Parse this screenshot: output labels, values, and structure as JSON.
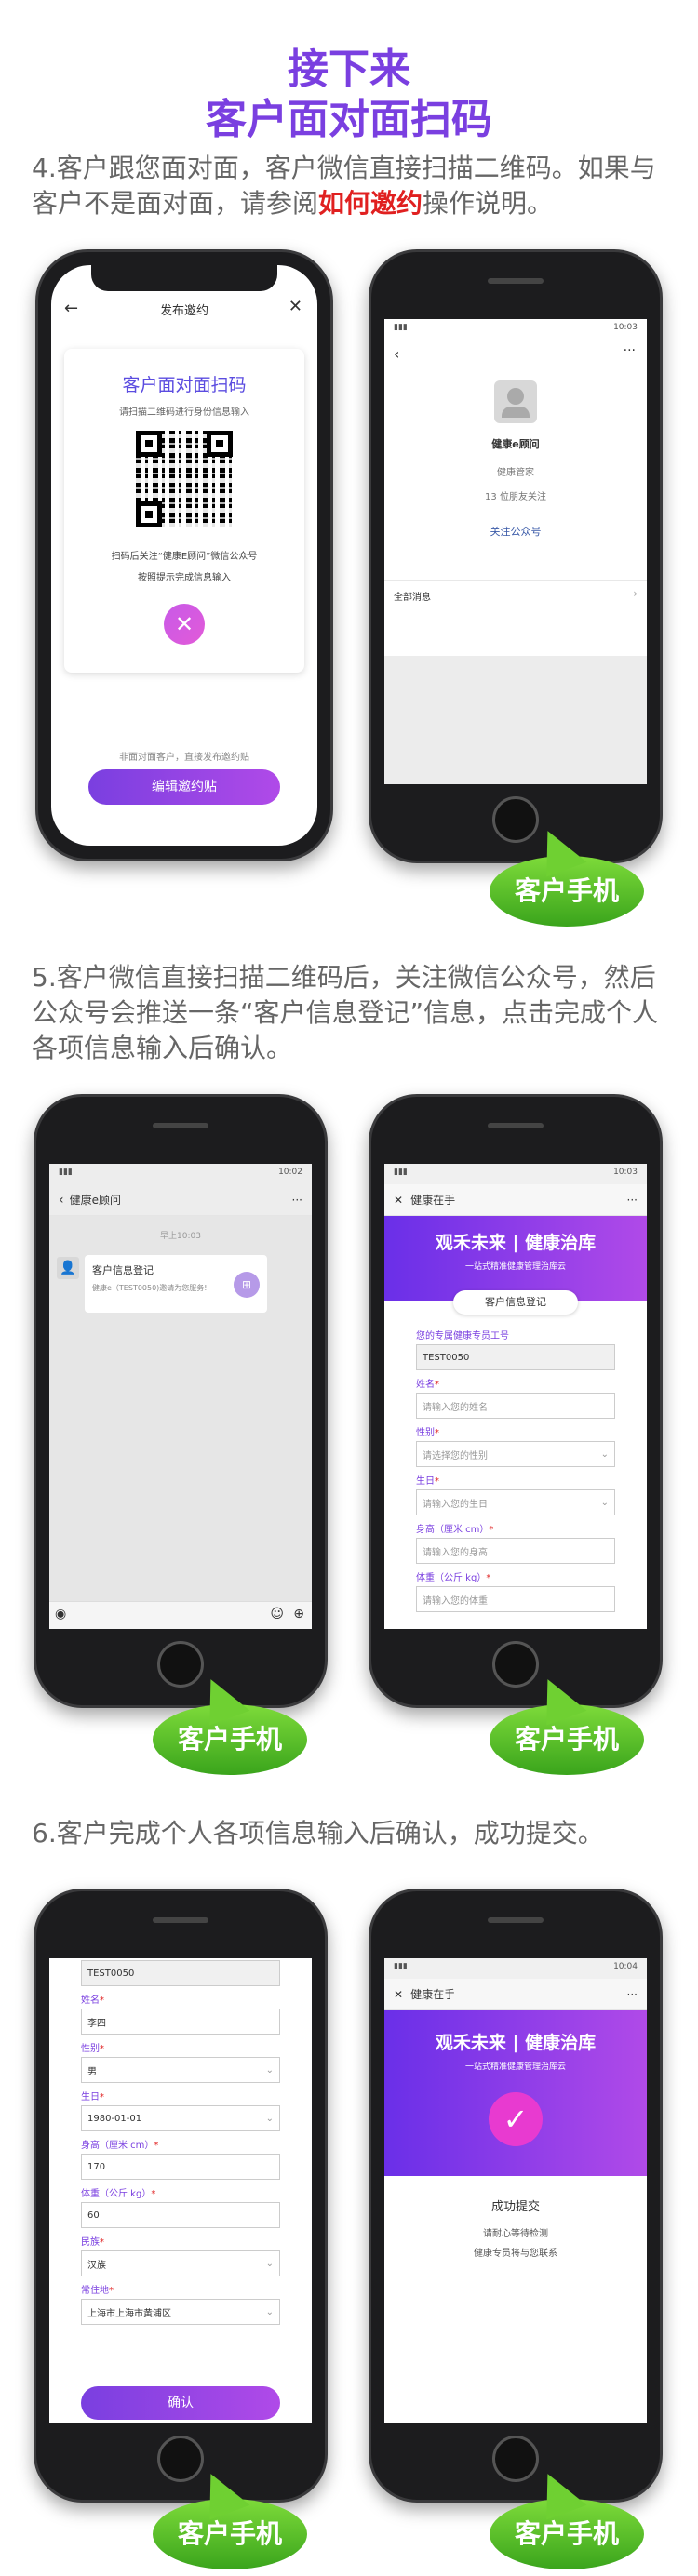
{
  "header": {
    "line1": "接下来",
    "line2": "客户面对面扫码"
  },
  "steps": {
    "s4_pre": "4.客户跟您面对面，客户微信直接扫描二维码。如果与客户不是面对面，请参阅",
    "s4_link": "如何邀约",
    "s4_post": "操作说明。",
    "s5": "5.客户微信直接扫描二维码后，关注微信公众号，然后公众号会推送一条“客户信息登记”信息，点击完成个人各项信息输入后确认。",
    "s6": "6.客户完成个人各项信息输入后确认，成功提交。"
  },
  "bubble_label": "客户手机",
  "phone1": {
    "nav_title": "发布邀约",
    "card_title": "客户面对面扫码",
    "card_sub": "请扫描二维码进行身份信息输入",
    "card_note1": "扫码后关注“健康E顾问”微信公众号",
    "card_note2": "按照提示完成信息输入",
    "footer_text": "非面对面客户，直接发布邀约贴",
    "button": "编辑邀约贴"
  },
  "phone2": {
    "account_name": "健康e顾问",
    "account_desc": "健康管家",
    "friends": "13 位朋友关注",
    "follow": "关注公众号",
    "all_msgs": "全部消息",
    "time": "10:03"
  },
  "phone3": {
    "nav_title": "健康e顾问",
    "time": "早上10:03",
    "card_title": "客户信息登记",
    "card_sub": "健康e（TEST0050)邀请为您服务!",
    "status_time": "10:02"
  },
  "phone4": {
    "nav_title": "健康在手",
    "banner_a": "观禾未来",
    "banner_b": "健康治库",
    "banner_sub": "一站式精准健康管理治库云",
    "tab": "客户信息登记",
    "status_time": "10:03",
    "fields": [
      {
        "label": "您的专属健康专员工号",
        "req": "",
        "value": "TEST0050",
        "kind": "grey"
      },
      {
        "label": "姓名",
        "req": "*",
        "value": "请输入您的姓名",
        "kind": "input"
      },
      {
        "label": "性别",
        "req": "*",
        "value": "请选择您的性别",
        "kind": "select"
      },
      {
        "label": "生日",
        "req": "*",
        "value": "请输入您的生日",
        "kind": "select"
      },
      {
        "label": "身高（厘米 cm）",
        "req": "*",
        "value": "请输入您的身高",
        "kind": "input"
      },
      {
        "label": "体重（公斤 kg）",
        "req": "*",
        "value": "请输入您的体重",
        "kind": "input"
      }
    ]
  },
  "phone5": {
    "fields": [
      {
        "label": "",
        "req": "",
        "value": "TEST0050",
        "kind": "grey"
      },
      {
        "label": "姓名",
        "req": "*",
        "value": "李四",
        "kind": "input"
      },
      {
        "label": "性别",
        "req": "*",
        "value": "男",
        "kind": "select"
      },
      {
        "label": "生日",
        "req": "*",
        "value": "1980-01-01",
        "kind": "select"
      },
      {
        "label": "身高（厘米 cm）",
        "req": "*",
        "value": "170",
        "kind": "input"
      },
      {
        "label": "体重（公斤 kg）",
        "req": "*",
        "value": "60",
        "kind": "input"
      },
      {
        "label": "民族",
        "req": "*",
        "value": "汉族",
        "kind": "select"
      },
      {
        "label": "常住地",
        "req": "*",
        "value": "上海市上海市黄浦区",
        "kind": "select"
      }
    ],
    "button": "确认"
  },
  "phone6": {
    "nav_title": "健康在手",
    "banner_a": "观禾未来",
    "banner_b": "健康治库",
    "banner_sub": "一站式精准健康管理治库云",
    "success": "成功提交",
    "line1": "请耐心等待检测",
    "line2": "健康专员将与您联系",
    "status_time": "10:04"
  }
}
